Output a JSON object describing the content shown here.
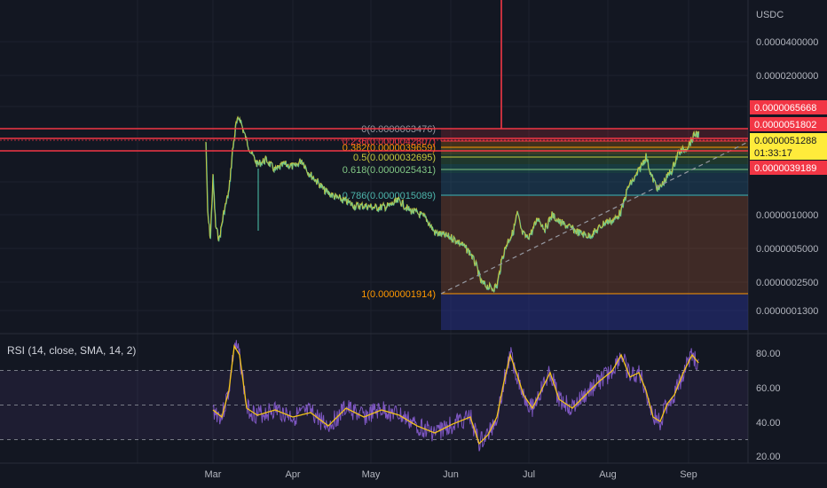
{
  "app": {
    "symbol_currency": "USDC",
    "theme_bg": "#131722"
  },
  "colors": {
    "price_line": "#c8c83c",
    "price_line_alt": "#4ec9b0",
    "red_line": "#f23645",
    "rsi_line": "#7e57c2",
    "rsi_ma": "#f5c518",
    "trend": "#9598a1"
  },
  "price_axis": {
    "labels": [
      "0.0000400000",
      "0.0000200000",
      "0.0000010000",
      "0.0000005000",
      "0.0000002500",
      "0.0000001300"
    ]
  },
  "price_tags": {
    "red_1": "0.0000065668",
    "red_2": "0.0000051802",
    "current": "0.0000051288",
    "countdown": "01:33:17",
    "red_3": "0.0000039189"
  },
  "fib_levels": [
    {
      "label": "0(0.0000063476)",
      "color": "#9598a1"
    },
    {
      "label": "0.236(0.0000042807)",
      "color": "#f23645"
    },
    {
      "label": "0.382(0.0000039659)",
      "color": "#ff9800"
    },
    {
      "label": "0.5(0.0000032695)",
      "color": "#c8c83c"
    },
    {
      "label": "0.618(0.0000025431)",
      "color": "#81c784"
    },
    {
      "label": "0.786(0.0000015089)",
      "color": "#4db6ac"
    },
    {
      "label": "1(0.0000001914)",
      "color": "#ff9800"
    }
  ],
  "rsi": {
    "title": "RSI (14, close, SMA, 14, 2)",
    "axis_labels": [
      "80.00",
      "60.00",
      "40.00",
      "20.00"
    ],
    "levels": [
      70,
      50,
      30
    ]
  },
  "time_axis": {
    "labels": [
      "Mar",
      "Apr",
      "May",
      "Jun",
      "Jul",
      "Aug",
      "Sep"
    ]
  },
  "chart_data": [
    {
      "type": "line",
      "title": "",
      "ylabel": "USDC",
      "y_scale": "log",
      "x": [
        "Mar",
        "Mar",
        "Mar",
        "Mar",
        "Apr",
        "Apr",
        "May",
        "May",
        "Jun",
        "Jun",
        "Jun",
        "Jul",
        "Jul",
        "Aug",
        "Aug",
        "Aug",
        "Sep"
      ],
      "series": [
        {
          "values": [
            3e-06,
            6e-07,
            6e-06,
            3.5e-06,
            3e-06,
            2.5e-06,
            1.6e-06,
            1.3e-06,
            6e-07,
            2.5e-07,
            2e-07,
            8e-07,
            9e-07,
            1.1e-06,
            3e-06,
            2e-06,
            5.5e-06
          ]
        }
      ]
    },
    {
      "type": "line",
      "title": "RSI (14, close, SMA, 14, 2)",
      "ylim": [
        20,
        90
      ],
      "x": [
        "Mar",
        "Mar",
        "Apr",
        "Apr",
        "May",
        "May",
        "Jun",
        "Jun",
        "Jul",
        "Jul",
        "Aug",
        "Aug",
        "Sep"
      ],
      "series": [
        {
          "values": [
            42,
            80,
            48,
            46,
            50,
            44,
            46,
            35,
            70,
            55,
            68,
            45,
            75
          ]
        }
      ]
    }
  ]
}
